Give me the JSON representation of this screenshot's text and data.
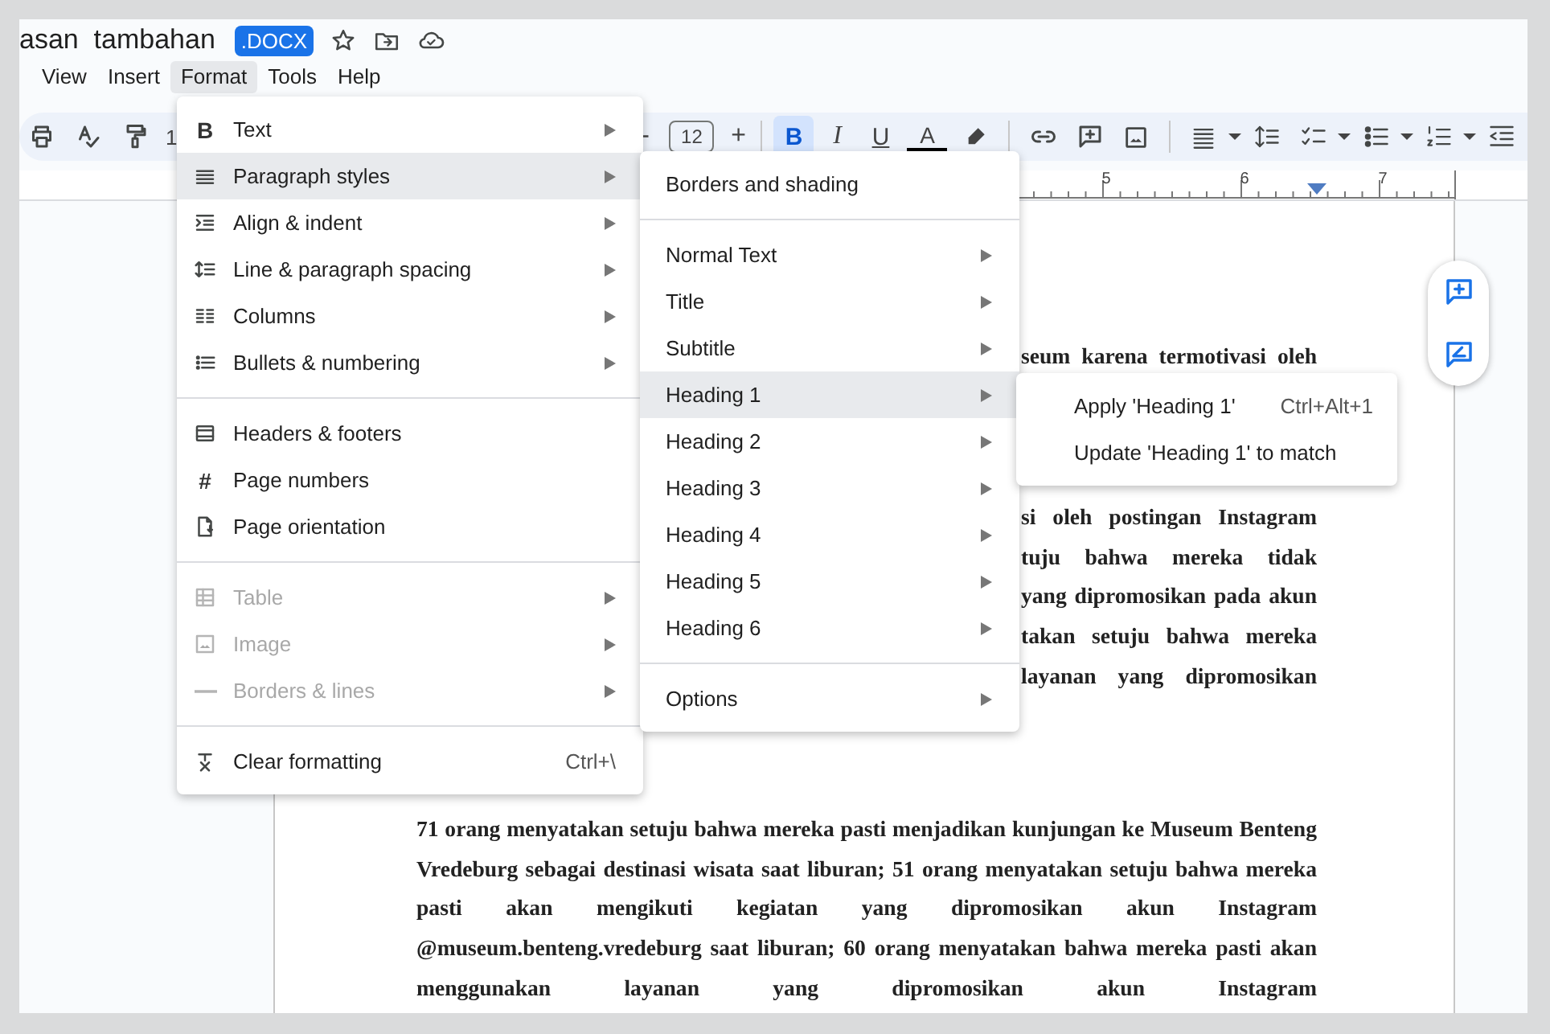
{
  "title_bar": {
    "title": "asan  tambahan",
    "badge": ".DOCX"
  },
  "menu_bar": [
    {
      "label": "View",
      "selected": false
    },
    {
      "label": "Insert",
      "selected": false
    },
    {
      "label": "Format",
      "selected": true
    },
    {
      "label": "Tools",
      "selected": false
    },
    {
      "label": "Help",
      "selected": false
    }
  ],
  "toolbar": {
    "zoom": "1",
    "decrease": "-",
    "font_size": "12",
    "increase": "+",
    "format_buttons": [
      {
        "glyph": "B",
        "selected": true
      },
      {
        "glyph": "I",
        "selected": false
      },
      {
        "glyph": "U",
        "selected": false
      }
    ],
    "text_color": "A"
  },
  "ruler": {
    "numbers": [
      "5",
      "6",
      "7"
    ]
  },
  "format_menu": {
    "sections": [
      {
        "items": [
          {
            "label": "Text",
            "glyph": "B",
            "submenu": true,
            "selected": false,
            "disabled": false
          },
          {
            "label": "Paragraph styles",
            "submenu": true,
            "selected": true,
            "disabled": false
          },
          {
            "label": "Align & indent",
            "submenu": true,
            "selected": false,
            "disabled": false
          },
          {
            "label": "Line & paragraph spacing",
            "submenu": true,
            "selected": false,
            "disabled": false
          },
          {
            "label": "Columns",
            "submenu": true,
            "selected": false,
            "disabled": false
          },
          {
            "label": "Bullets & numbering",
            "submenu": true,
            "selected": false,
            "disabled": false
          }
        ]
      },
      {
        "items": [
          {
            "label": "Headers & footers",
            "submenu": false,
            "selected": false,
            "disabled": false
          },
          {
            "label": "Page numbers",
            "glyph": "#",
            "submenu": false,
            "selected": false,
            "disabled": false
          },
          {
            "label": "Page orientation",
            "submenu": false,
            "selected": false,
            "disabled": false
          }
        ]
      },
      {
        "items": [
          {
            "label": "Table",
            "submenu": true,
            "selected": false,
            "disabled": true
          },
          {
            "label": "Image",
            "submenu": true,
            "selected": false,
            "disabled": true
          },
          {
            "label": "Borders & lines",
            "submenu": true,
            "selected": false,
            "disabled": true
          }
        ]
      },
      {
        "items": [
          {
            "label": "Clear formatting",
            "shortcut": "Ctrl+\\",
            "submenu": false,
            "selected": false,
            "disabled": false
          }
        ]
      }
    ]
  },
  "paragraph_styles_menu": {
    "sections": [
      {
        "items": [
          {
            "label": "Borders and shading",
            "submenu": false,
            "selected": false
          }
        ]
      },
      {
        "items": [
          {
            "label": "Normal Text",
            "submenu": true,
            "selected": false
          },
          {
            "label": "Title",
            "submenu": true,
            "selected": false
          },
          {
            "label": "Subtitle",
            "submenu": true,
            "selected": false
          },
          {
            "label": "Heading 1",
            "submenu": true,
            "selected": true
          },
          {
            "label": "Heading 2",
            "submenu": true,
            "selected": false
          },
          {
            "label": "Heading 3",
            "submenu": true,
            "selected": false
          },
          {
            "label": "Heading 4",
            "submenu": true,
            "selected": false
          },
          {
            "label": "Heading 5",
            "submenu": true,
            "selected": false
          },
          {
            "label": "Heading 6",
            "submenu": true,
            "selected": false
          }
        ]
      },
      {
        "items": [
          {
            "label": "Options",
            "submenu": true,
            "selected": false
          }
        ]
      }
    ]
  },
  "heading_menu": {
    "items": [
      {
        "label": "Apply 'Heading 1'",
        "shortcut": "Ctrl+Alt+1"
      },
      {
        "label": "Update 'Heading 1' to match"
      }
    ]
  },
  "document": {
    "fragments": [
      "seum karena termotivasi oleh",
      "si oleh postingan Instagram",
      "tuju bahwa mereka tidak",
      "yang dipromosikan pada akun",
      "takan setuju bahwa mereka",
      "layanan yang dipromosikan"
    ],
    "paragraph": "71 orang menyatakan setuju bahwa mereka pasti menjadikan kunjungan ke Museum Benteng Vredeburg sebagai destinasi wisata saat liburan; 51 orang menyatakan setuju bahwa mereka pasti akan mengikuti kegiatan yang dipromosikan akun Instagram @museum.benteng.vredeburg saat liburan; 60 orang menyatakan bahwa mereka pasti akan menggunakan layanan yang dipromosikan akun Instagram"
  }
}
